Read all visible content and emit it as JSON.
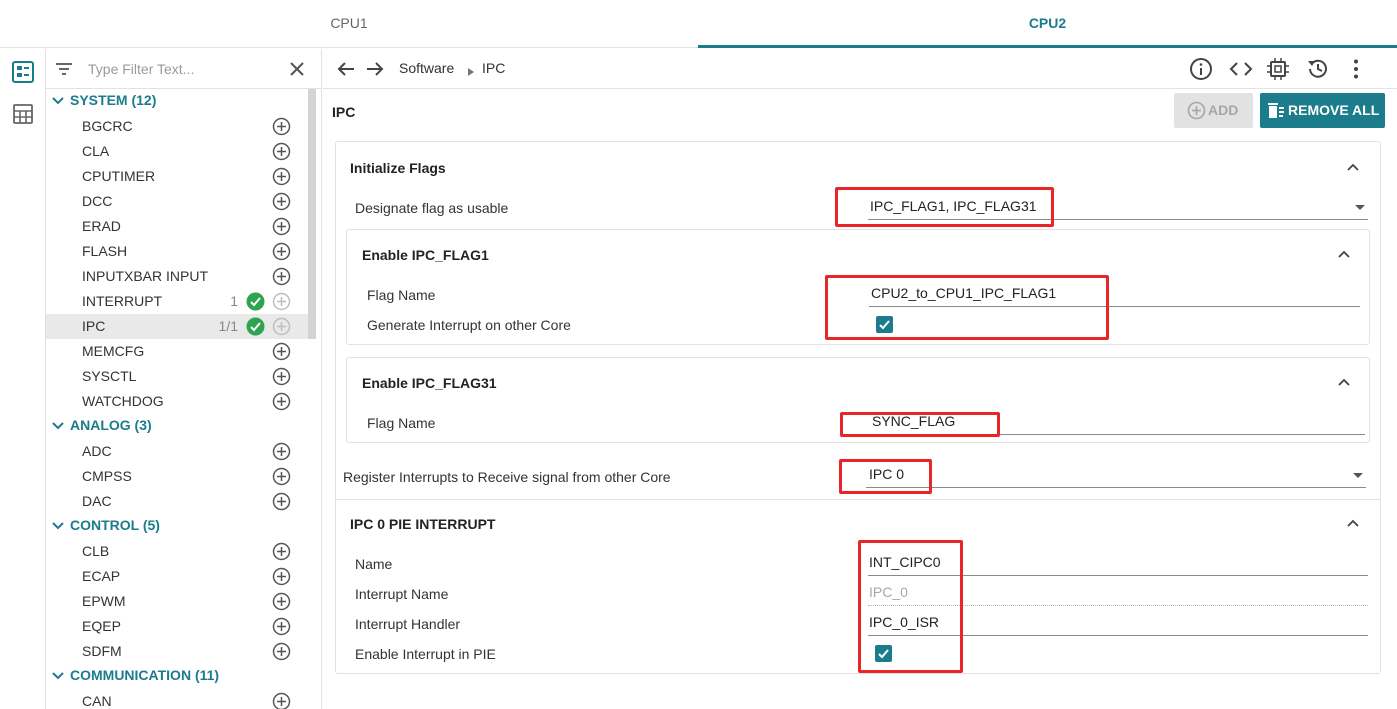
{
  "tabs": {
    "cpu1": "CPU1",
    "cpu2": "CPU2"
  },
  "filter": {
    "placeholder": "Type Filter Text..."
  },
  "sidebar": {
    "categories": [
      {
        "label": "SYSTEM (12)",
        "items": [
          {
            "label": "BGCRC"
          },
          {
            "label": "CLA"
          },
          {
            "label": "CPUTIMER"
          },
          {
            "label": "DCC"
          },
          {
            "label": "ERAD"
          },
          {
            "label": "FLASH"
          },
          {
            "label": "INPUTXBAR INPUT"
          },
          {
            "label": "INTERRUPT",
            "count": "1"
          },
          {
            "label": "IPC",
            "count": "1/1"
          },
          {
            "label": "MEMCFG"
          },
          {
            "label": "SYSCTL"
          },
          {
            "label": "WATCHDOG"
          }
        ]
      },
      {
        "label": "ANALOG (3)",
        "items": [
          {
            "label": "ADC"
          },
          {
            "label": "CMPSS"
          },
          {
            "label": "DAC"
          }
        ]
      },
      {
        "label": "CONTROL (5)",
        "items": [
          {
            "label": "CLB"
          },
          {
            "label": "ECAP"
          },
          {
            "label": "EPWM"
          },
          {
            "label": "EQEP"
          },
          {
            "label": "SDFM"
          }
        ]
      },
      {
        "label": "COMMUNICATION (11)",
        "items": [
          {
            "label": "CAN"
          }
        ]
      }
    ]
  },
  "breadcrumb": {
    "root": "Software",
    "current": "IPC"
  },
  "page": {
    "title": "IPC",
    "add_label": "ADD",
    "remove_all_label": "REMOVE ALL"
  },
  "init_flags": {
    "title": "Initialize Flags",
    "designate_label": "Designate flag as usable",
    "designate_value": "IPC_FLAG1, IPC_FLAG31",
    "flag1": {
      "title": "Enable IPC_FLAG1",
      "name_label": "Flag Name",
      "name_value": "CPU2_to_CPU1_IPC_FLAG1",
      "gen_int_label": "Generate Interrupt on other Core",
      "gen_int_checked": true
    },
    "flag31": {
      "title": "Enable IPC_FLAG31",
      "name_label": "Flag Name",
      "name_value": "SYNC_FLAG"
    }
  },
  "register": {
    "label": "Register Interrupts to Receive signal from other Core",
    "value": "IPC 0"
  },
  "pie": {
    "title": "IPC 0 PIE INTERRUPT",
    "name_label": "Name",
    "name_value": "INT_CIPC0",
    "int_name_label": "Interrupt Name",
    "int_name_value": "IPC_0",
    "handler_label": "Interrupt Handler",
    "handler_value": "IPC_0_ISR",
    "enable_label": "Enable Interrupt in PIE",
    "enable_checked": true
  },
  "colors": {
    "accent": "#1b7c8c",
    "highlight": "#e8262a",
    "check_green": "#2ea44f"
  }
}
